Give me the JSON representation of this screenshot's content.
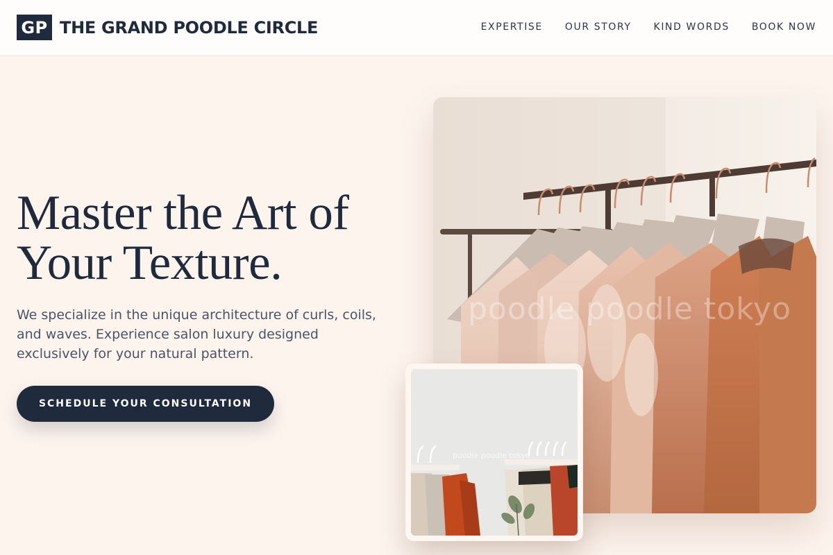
{
  "brand": {
    "mark": "GP",
    "name": "THE GRAND POODLE CIRCLE"
  },
  "nav": {
    "items": [
      {
        "label": "EXPERTISE"
      },
      {
        "label": "OUR STORY"
      },
      {
        "label": "KIND WORDS"
      },
      {
        "label": "BOOK NOW"
      }
    ]
  },
  "hero": {
    "title_line1": "Master the Art of",
    "title_line2": "Your Texture.",
    "subtitle": "We specialize in the unique architecture of curls, coils, and waves. Experience salon luxury designed exclusively for your natural pattern.",
    "cta_label": "SCHEDULE YOUR CONSULTATION"
  },
  "images": {
    "main_watermark": "poodle poodle tokyo",
    "inset_watermark": "poodle poodle tokyo"
  },
  "colors": {
    "navy": "#1f2a3d",
    "background": "#fdf4ee",
    "header_bg": "#fffdfb",
    "body_text": "#4a5468"
  }
}
